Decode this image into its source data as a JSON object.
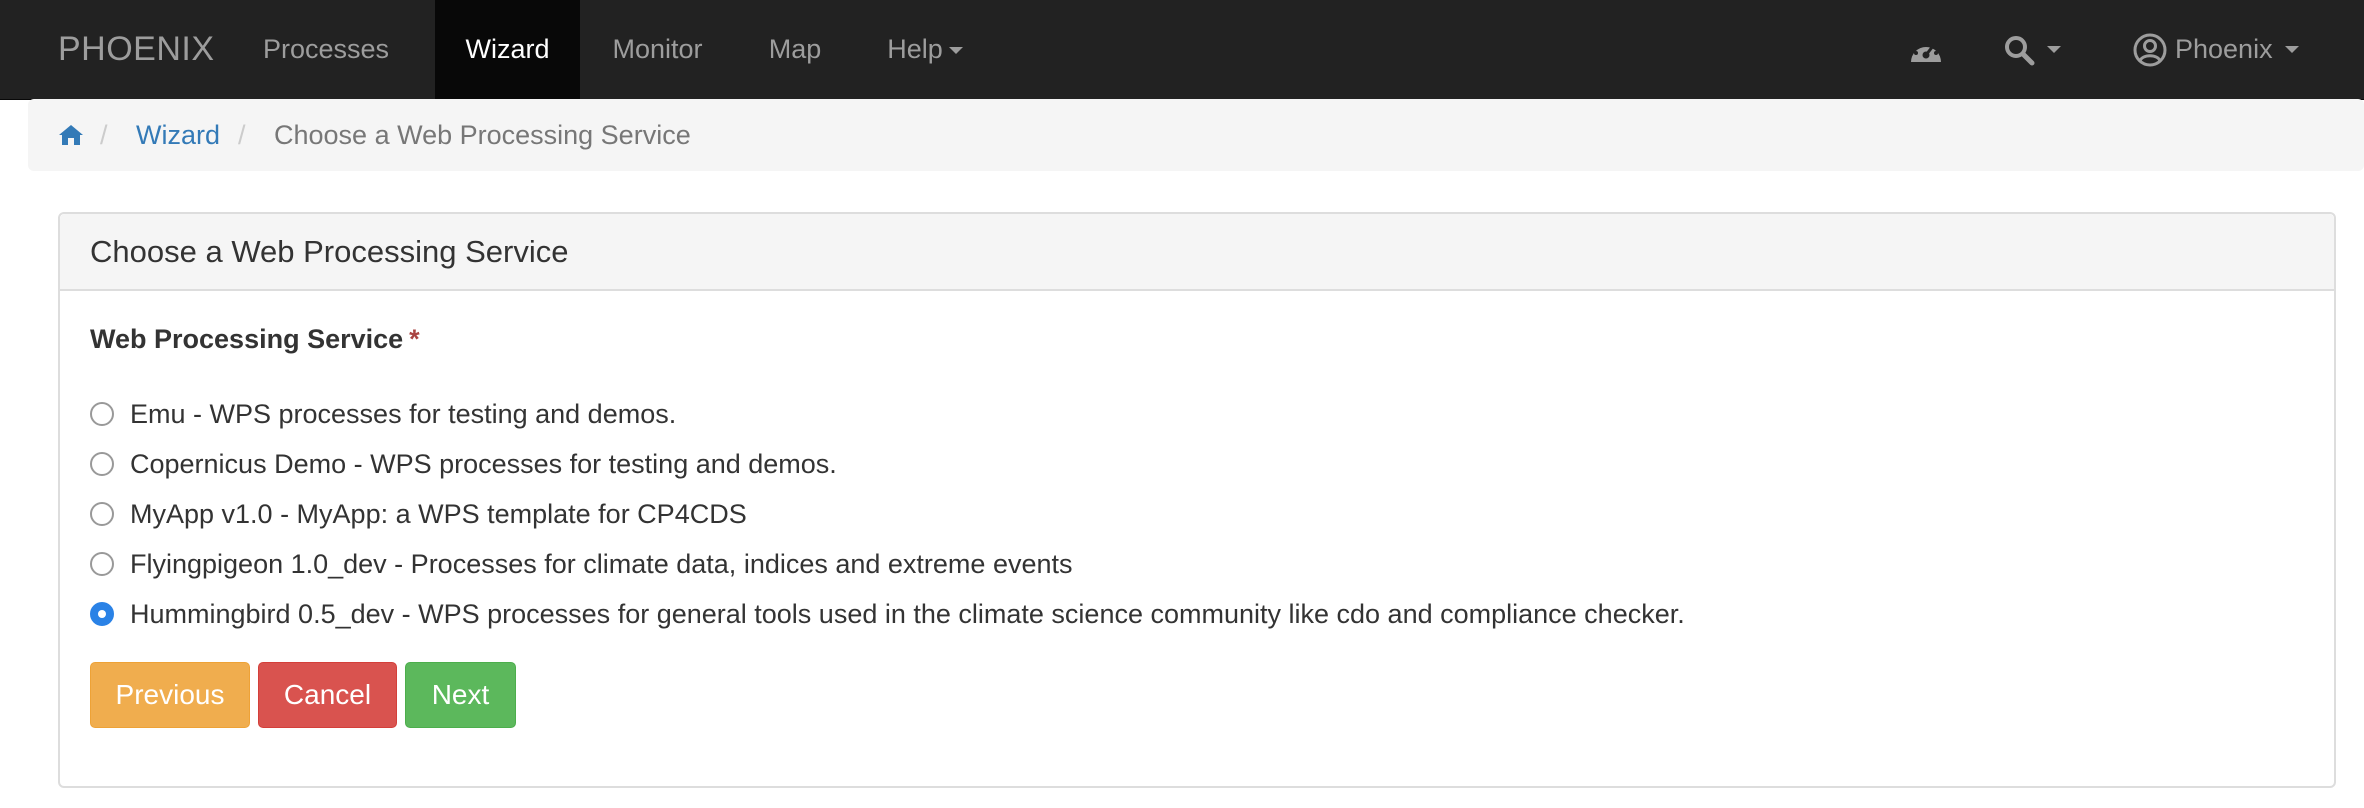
{
  "navbar": {
    "brand": "PHOENIX",
    "items": [
      {
        "label": "Processes"
      },
      {
        "label": "Wizard",
        "active": true
      },
      {
        "label": "Monitor"
      },
      {
        "label": "Map"
      },
      {
        "label": "Help"
      }
    ],
    "user_label": "Phoenix",
    "icons": [
      "dashboard-icon",
      "search-icon",
      "user-circle-icon",
      "caret-down-icon"
    ]
  },
  "breadcrumb": {
    "home_icon": "home-icon",
    "items": [
      "Wizard",
      "Choose a Web Processing Service"
    ],
    "separator": "/"
  },
  "panel": {
    "title": "Choose a Web Processing Service",
    "field_label": "Web Processing Service",
    "required_mark": "*",
    "options": [
      {
        "label": "Emu - WPS processes for testing and demos.",
        "checked": false
      },
      {
        "label": "Copernicus Demo - WPS processes for testing and demos.",
        "checked": false
      },
      {
        "label": "MyApp v1.0 - MyApp: a WPS template for CP4CDS",
        "checked": false
      },
      {
        "label": "Flyingpigeon 1.0_dev - Processes for climate data, indices and extreme events",
        "checked": false
      },
      {
        "label": "Hummingbird 0.5_dev - WPS processes for general tools used in the climate science community like cdo and compliance checker.",
        "checked": true
      }
    ]
  },
  "buttons": {
    "previous": "Previous",
    "cancel": "Cancel",
    "next": "Next"
  },
  "colors": {
    "navbar_bg": "#222222",
    "link": "#337ab7",
    "warning": "#f0ad4e",
    "danger": "#d9534f",
    "success": "#5cb85c",
    "radio_checked": "#2a82e6"
  }
}
